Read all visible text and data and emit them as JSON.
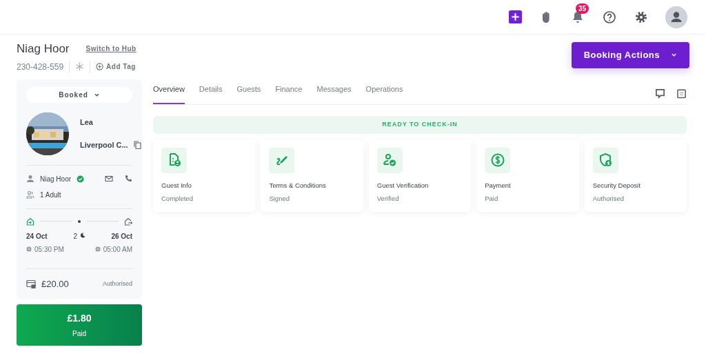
{
  "topbar": {
    "notification_count": "35"
  },
  "guest": {
    "name": "Niag Hoor",
    "switch_link": "Switch to Hub",
    "phone": "230-428-559",
    "add_tag": "Add Tag"
  },
  "booking_actions": "Booking Actions",
  "sidebar": {
    "status": "Booked",
    "property_name": "Lea",
    "property_location": "Liverpool C...",
    "guest_name": "Niag Hoor",
    "guest_verified": true,
    "guests": "1 Adult",
    "check_in_date": "24 Oct",
    "check_in_time": "05:30 PM",
    "nights": "2",
    "check_out_date": "26 Oct",
    "check_out_time": "05:00 AM",
    "deposit_amount": "£20.00",
    "deposit_status": "Authorised"
  },
  "paid": {
    "amount": "£1.80",
    "label": "Paid"
  },
  "tabs": [
    {
      "label": "Overview",
      "selected": true
    },
    {
      "label": "Details",
      "selected": false
    },
    {
      "label": "Guests",
      "selected": false
    },
    {
      "label": "Finance",
      "selected": false
    },
    {
      "label": "Messages",
      "selected": false
    },
    {
      "label": "Operations",
      "selected": false
    }
  ],
  "banner": "READY TO CHECK-IN",
  "steps": [
    {
      "kind": "document",
      "title": "Guest Info",
      "status": "Completed"
    },
    {
      "kind": "signature",
      "title": "Terms & Conditions",
      "status": "Signed"
    },
    {
      "kind": "verification",
      "title": "Guest Verification",
      "status": "Verified"
    },
    {
      "kind": "payment",
      "title": "Payment",
      "status": "Paid"
    },
    {
      "kind": "deposit",
      "title": "Security Deposit",
      "status": "Authorised"
    }
  ]
}
